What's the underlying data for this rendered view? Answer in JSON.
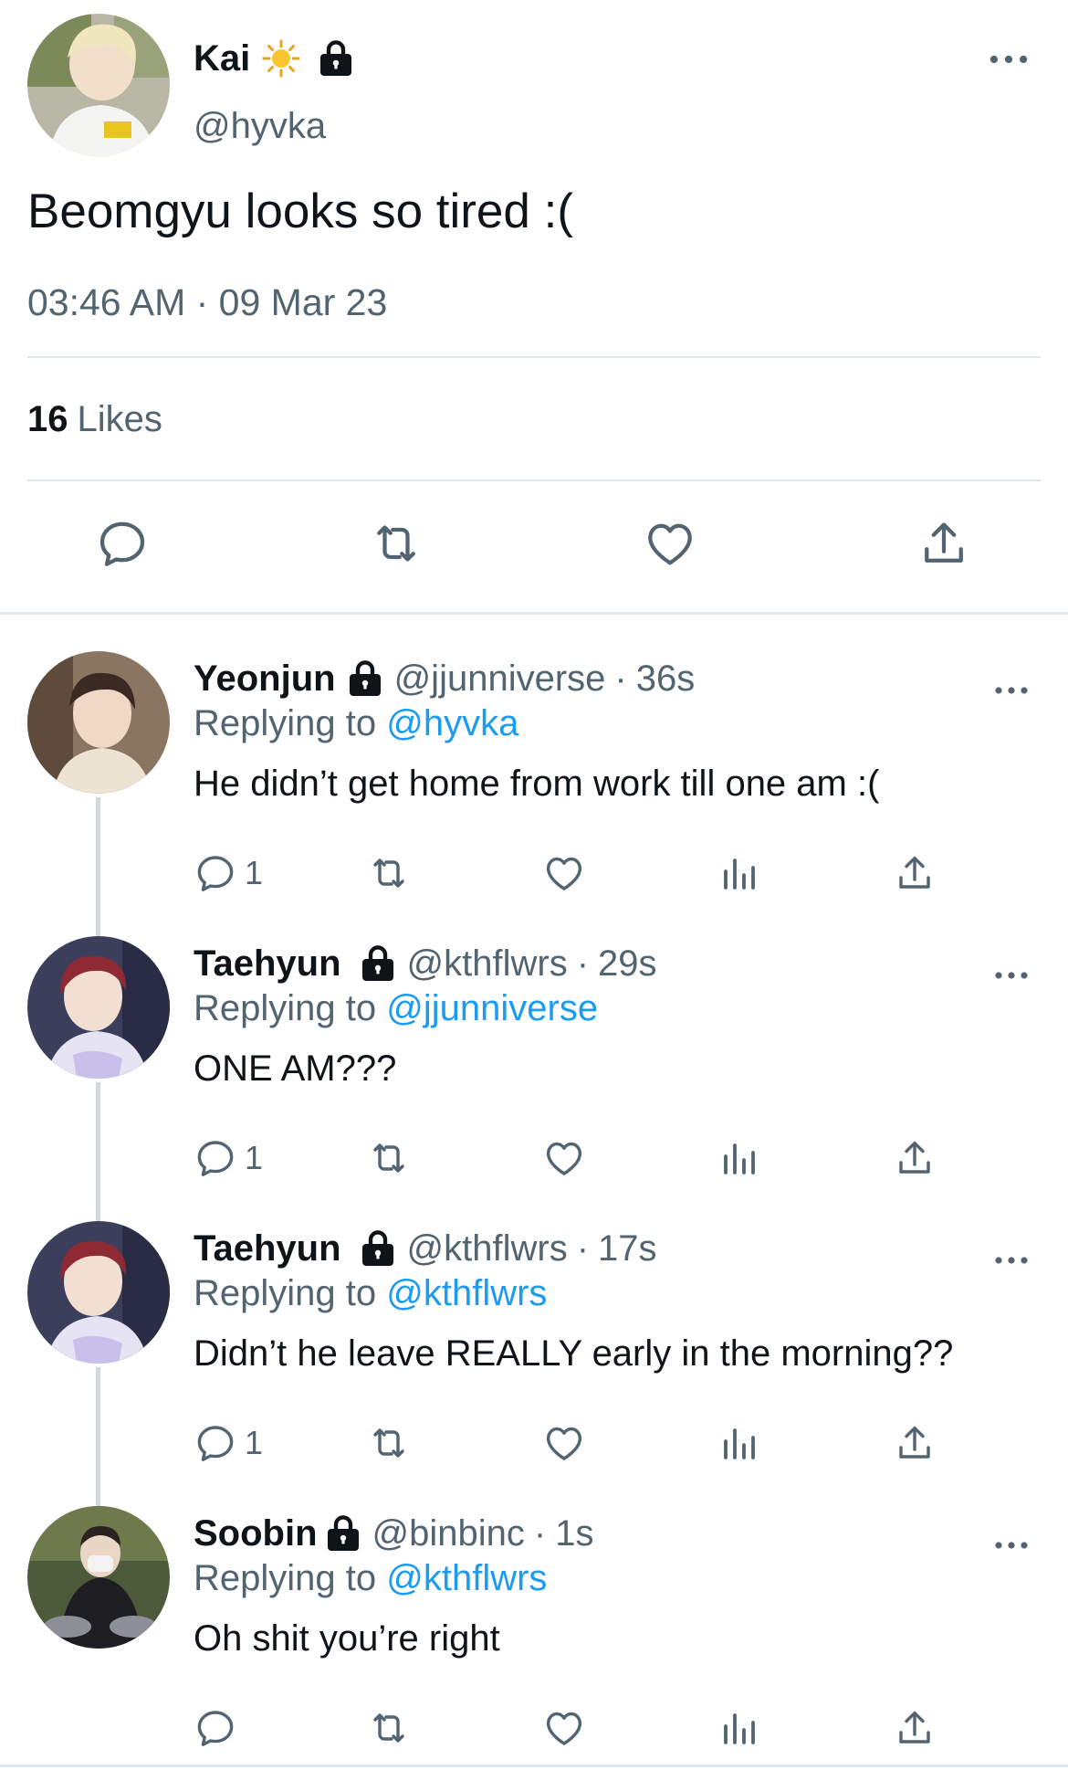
{
  "main_tweet": {
    "display_name": "Kai",
    "name_emoji_icon": "sun-icon",
    "protected_icon": "lock-icon",
    "handle": "@hyvka",
    "text": "Beomgyu looks so tired :(",
    "timestamp": "03:46 AM · 09 Mar 23",
    "likes_count": "16",
    "likes_label": "Likes",
    "actions": [
      "reply-icon",
      "retweet-icon",
      "like-icon",
      "share-icon"
    ]
  },
  "replies": [
    {
      "display_name": "Yeonjun",
      "handle": "@jjunniverse",
      "separator": "·",
      "age": "36s",
      "replying_prefix": "Replying to",
      "replying_to": "@hyvka",
      "text": "He didn’t get home from work till one am :(",
      "reply_count": "1"
    },
    {
      "display_name": "Taehyun",
      "handle": "@kthflwrs",
      "separator": "·",
      "age": "29s",
      "replying_prefix": "Replying to",
      "replying_to": "@jjunniverse",
      "text": "ONE AM???",
      "reply_count": "1"
    },
    {
      "display_name": "Taehyun",
      "handle": "@kthflwrs",
      "separator": "·",
      "age": "17s",
      "replying_prefix": "Replying to",
      "replying_to": "@kthflwrs",
      "text": "Didn’t he leave REALLY early in the morning??",
      "reply_count": "1"
    },
    {
      "display_name": "Soobin",
      "handle": "@binbinc",
      "separator": "·",
      "age": "1s",
      "replying_prefix": "Replying to",
      "replying_to": "@kthflwrs",
      "text": "Oh shit you’re right",
      "reply_count": ""
    }
  ],
  "colors": {
    "text_primary": "#0f1419",
    "text_secondary": "#536471",
    "link": "#1d9bf0",
    "divider": "#e1e6ea",
    "thread_line": "#cfd9de"
  }
}
